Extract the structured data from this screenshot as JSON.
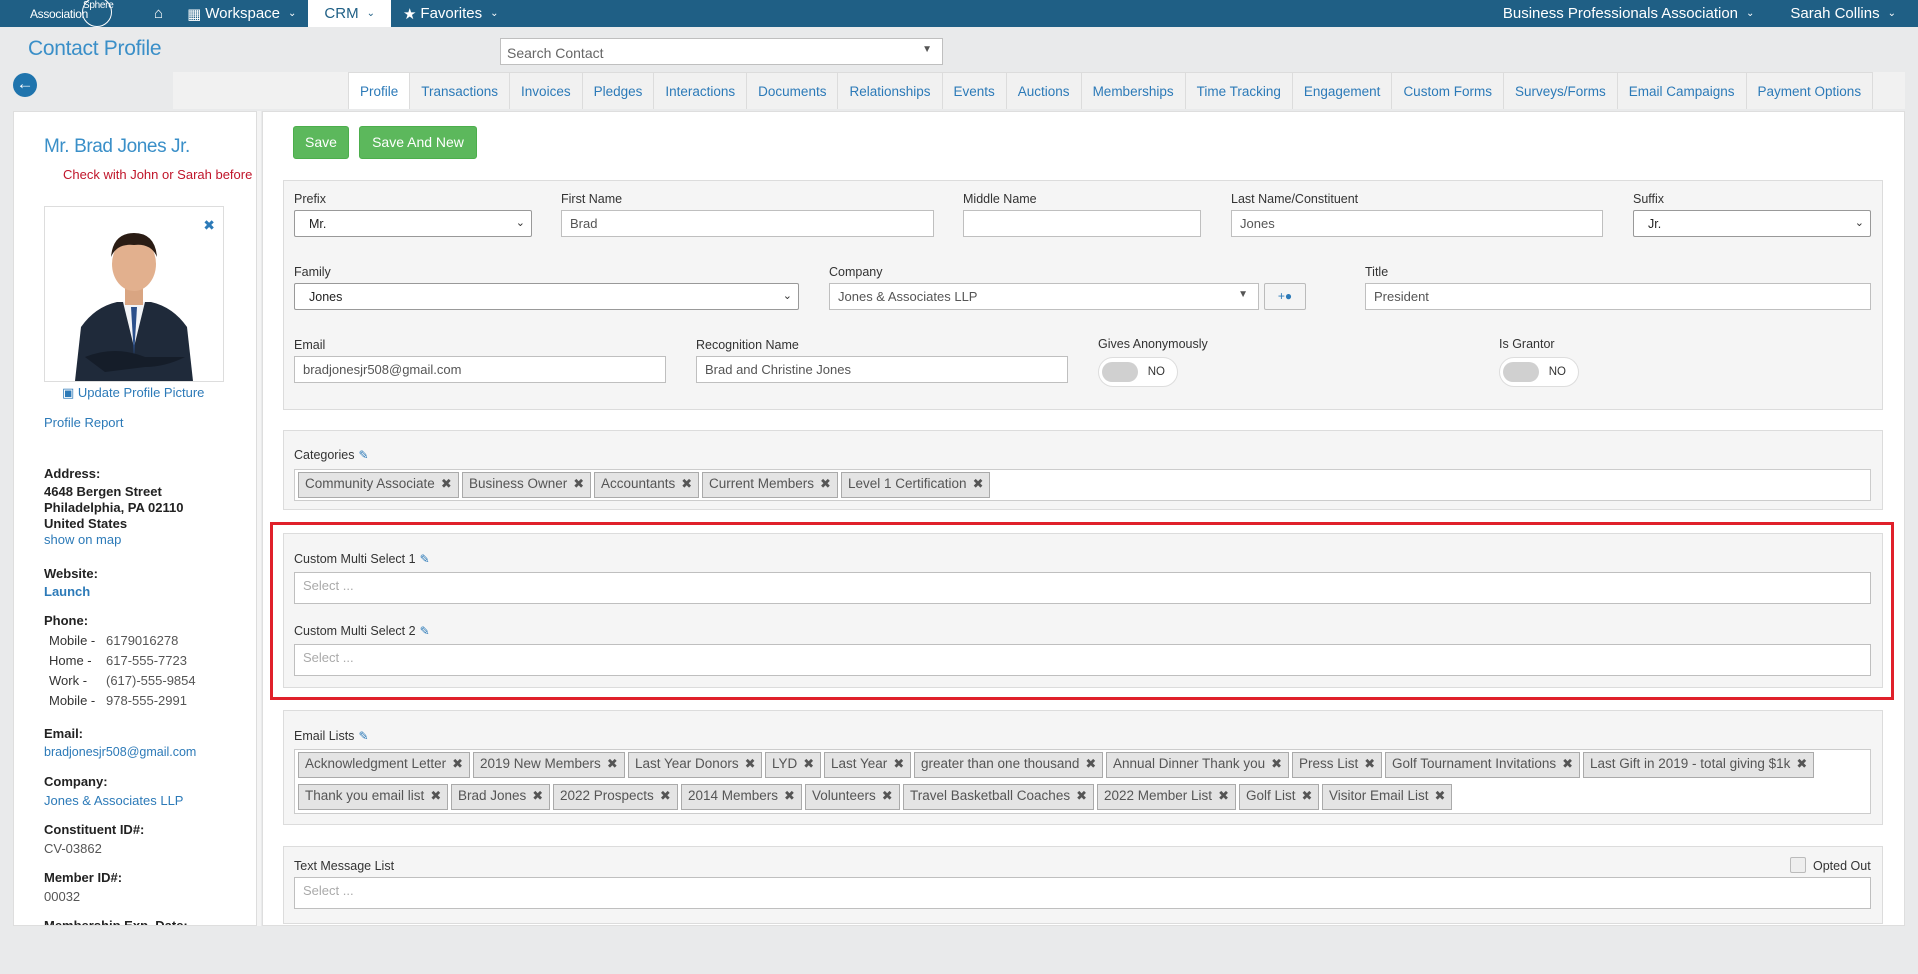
{
  "nav": {
    "logo_text": "Association",
    "logo_sub": "Sphere",
    "home_icon": "home-icon",
    "workspace": "Workspace",
    "crm": "CRM",
    "favorites": "Favorites",
    "org": "Business Professionals Association",
    "user": "Sarah Collins"
  },
  "header": {
    "title": "Contact Profile",
    "search_placeholder": "Search Contact"
  },
  "tabs": [
    "Profile",
    "Transactions",
    "Invoices",
    "Pledges",
    "Interactions",
    "Documents",
    "Relationships",
    "Events",
    "Auctions",
    "Memberships",
    "Time Tracking",
    "Engagement",
    "Custom Forms",
    "Surveys/Forms",
    "Email Campaigns",
    "Payment Options"
  ],
  "sidebar": {
    "name": "Mr. Brad Jones Jr.",
    "note": "Check with John or Sarah before",
    "update_picture": "Update Profile Picture",
    "profile_report": "Profile Report",
    "address_label": "Address:",
    "address_line1": "4648 Bergen Street",
    "address_line2": "Philadelphia, PA 02110",
    "address_line3": "United States",
    "show_on_map": "show on map",
    "website_label": "Website:",
    "website_link": "Launch",
    "phone_label": "Phone:",
    "phones": [
      {
        "type": "Mobile -",
        "number": "6179016278"
      },
      {
        "type": "Home -",
        "number": "617-555-7723"
      },
      {
        "type": "Work -",
        "number": "(617)-555-9854"
      },
      {
        "type": "Mobile -",
        "number": "978-555-2991"
      }
    ],
    "email_label": "Email:",
    "email": "bradjonesjr508@gmail.com",
    "company_label": "Company:",
    "company": "Jones & Associates LLP",
    "constituent_label": "Constituent ID#:",
    "constituent_id": "CV-03862",
    "member_label": "Member ID#:",
    "member_id": "00032",
    "membership_exp_label": "Membership Exp. Date:"
  },
  "buttons": {
    "save": "Save",
    "save_and_new": "Save And New"
  },
  "form": {
    "prefix_label": "Prefix",
    "prefix": "Mr.",
    "first_name_label": "First Name",
    "first_name": "Brad",
    "middle_name_label": "Middle Name",
    "middle_name": "",
    "last_name_label": "Last Name/Constituent",
    "last_name": "Jones",
    "suffix_label": "Suffix",
    "suffix": "Jr.",
    "family_label": "Family",
    "family": "Jones",
    "company_label": "Company",
    "company": "Jones & Associates LLP",
    "add_company": "+",
    "title_label": "Title",
    "title": "President",
    "email_label": "Email",
    "email": "bradjonesjr508@gmail.com",
    "recognition_label": "Recognition Name",
    "recognition": "Brad and Christine Jones",
    "gives_anon_label": "Gives Anonymously",
    "gives_anon": "NO",
    "is_grantor_label": "Is Grantor",
    "is_grantor": "NO"
  },
  "categories": {
    "label": "Categories",
    "items": [
      "Community Associate",
      "Business Owner",
      "Accountants",
      "Current Members",
      "Level 1 Certification"
    ]
  },
  "custom": {
    "ms1_label": "Custom Multi Select 1",
    "ms1_placeholder": "Select ...",
    "ms2_label": "Custom Multi Select 2",
    "ms2_placeholder": "Select ..."
  },
  "email_lists": {
    "label": "Email Lists",
    "row1": [
      "Acknowledgment Letter",
      "2019 New Members",
      "Last Year Donors",
      "LYD",
      "Last Year",
      "greater than one thousand",
      "Annual Dinner Thank you",
      "Press List",
      "Golf Tournament Invitations",
      "Last Gift in 2019 - total giving $1k"
    ],
    "row2": [
      "Thank you email list",
      "Brad Jones",
      "2022 Prospects",
      "2014 Members",
      "Volunteers",
      "Travel Basketball Coaches",
      "2022 Member List",
      "Golf List",
      "Visitor Email List"
    ]
  },
  "text_list": {
    "label": "Text Message List",
    "placeholder": "Select ...",
    "opted_out": "Opted Out"
  }
}
